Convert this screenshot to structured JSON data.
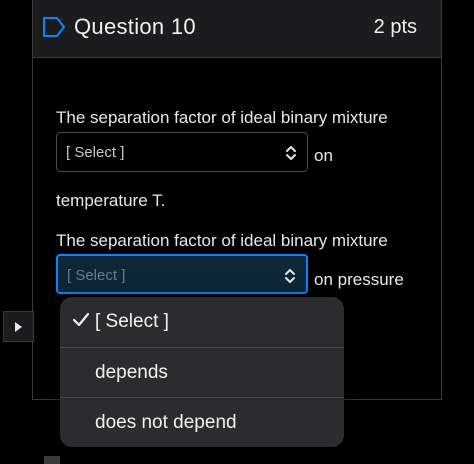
{
  "question": {
    "title": "Question 10",
    "points": "2 pts"
  },
  "content": {
    "line1": "The separation factor of ideal binary mixture",
    "select1_value": "[ Select ]",
    "after_select1": "on",
    "line2": "temperature T.",
    "line3": "The separation factor of ideal binary mixture",
    "select2_value": "[ Select ]",
    "after_select2": "on pressure"
  },
  "dropdown": {
    "options": [
      {
        "label": "[ Select ]",
        "selected": true
      },
      {
        "label": "depends",
        "selected": false
      },
      {
        "label": "does not depend",
        "selected": false
      }
    ]
  },
  "icons": {
    "flag": "flag-outline-icon",
    "chevron": "chevron-up-down-icon",
    "play": "play-icon",
    "check": "checkmark-icon"
  },
  "colors": {
    "focus_border": "#0a84ff",
    "header_bg": "#1c1c1e",
    "dropdown_bg": "#2c2c2e"
  }
}
